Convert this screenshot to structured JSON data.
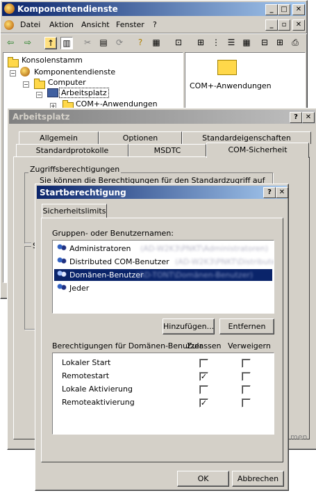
{
  "main_window": {
    "title": "Komponentendienste",
    "menu": [
      "Datei",
      "Aktion",
      "Ansicht",
      "Fenster",
      "?"
    ],
    "tree": [
      "Konsolenstamm",
      "Komponentendienste",
      "Computer",
      "Arbeitsplatz",
      "COM+-Anwendungen"
    ],
    "right_pane_item": "COM+-Anwendungen"
  },
  "props_dialog": {
    "title": "Arbeitsplatz",
    "tabs_row1": [
      "Allgemein",
      "Optionen",
      "Standardeigenschaften"
    ],
    "tabs_row2": [
      "Standardprotokolle",
      "MSDTC",
      "COM-Sicherheit"
    ],
    "group_title": "Zugriffsberechtigungen",
    "group_text": "Sie können die Berechtigungen für den Standardzugriff auf",
    "second_group_letter": "S",
    "hidden_button_text": "men"
  },
  "launch_dialog": {
    "title": "Startberechtigung",
    "tab": "Sicherheitslimits",
    "users_label": "Gruppen- oder Benutzernamen:",
    "users": [
      {
        "name": "Administratoren",
        "detail": "(AD-W2K3\\PNKT\\Administratoren)",
        "selected": false
      },
      {
        "name": "Distributed COM-Benutzer",
        "detail": "(AD-W2K3\\PNKT\\Distributed CO",
        "selected": false
      },
      {
        "name": "Domänen-Benutzer",
        "detail": "(AD-TONT\\Domänen-Benutzer)",
        "selected": true
      },
      {
        "name": "Jeder",
        "detail": "",
        "selected": false
      }
    ],
    "add_button": "Hinzufügen...",
    "remove_button": "Entfernen",
    "perm_label": "Berechtigungen für Domänen-Benutzer",
    "allow_header": "Zulassen",
    "deny_header": "Verweigern",
    "permissions": [
      {
        "name": "Lokaler Start",
        "allow": false,
        "deny": false
      },
      {
        "name": "Remotestart",
        "allow": true,
        "deny": false
      },
      {
        "name": "Lokale Aktivierung",
        "allow": false,
        "deny": false
      },
      {
        "name": "Remoteaktivierung",
        "allow": true,
        "deny": false
      }
    ],
    "ok_button": "OK",
    "cancel_button": "Abbrechen"
  },
  "icons": {
    "back": "back-arrow-icon",
    "forward": "forward-arrow-icon",
    "up": "up-folder-icon",
    "help": "question-mark-icon",
    "close": "close-icon"
  }
}
